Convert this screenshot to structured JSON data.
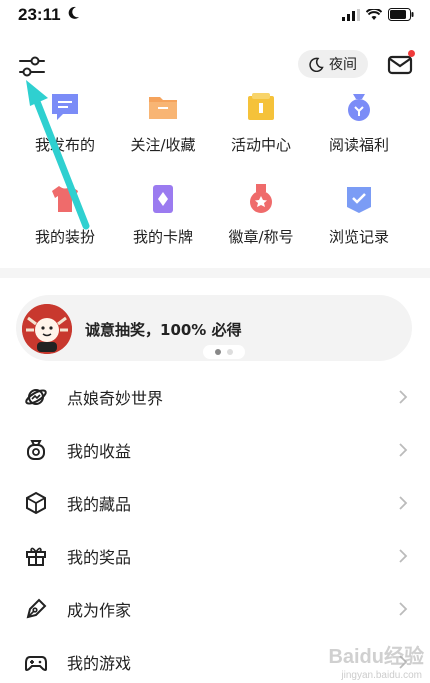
{
  "status_bar": {
    "time": "23:11"
  },
  "header": {
    "night_label": "夜间"
  },
  "grid": [
    {
      "label": "我发布的",
      "icon": "chat-bubble-icon",
      "color": "#7b8cf7"
    },
    {
      "label": "关注/收藏",
      "icon": "folder-icon",
      "color": "#f5a35c"
    },
    {
      "label": "活动中心",
      "icon": "gift-box-icon",
      "color": "#f5c23a"
    },
    {
      "label": "阅读福利",
      "icon": "coin-bag-icon",
      "color": "#7b8cf7"
    },
    {
      "label": "我的装扮",
      "icon": "tshirt-icon",
      "color": "#ef6b6b"
    },
    {
      "label": "我的卡牌",
      "icon": "card-icon",
      "color": "#9b7bf0"
    },
    {
      "label": "徽章/称号",
      "icon": "medal-icon",
      "color": "#ef6b6b"
    },
    {
      "label": "浏览记录",
      "icon": "history-icon",
      "color": "#7b9cf5"
    }
  ],
  "banner": {
    "text": "诚意抽奖，100% 必得"
  },
  "menu": [
    {
      "label": "点娘奇妙世界",
      "icon": "planet-icon"
    },
    {
      "label": "我的收益",
      "icon": "money-pot-icon"
    },
    {
      "label": "我的藏品",
      "icon": "cube-icon"
    },
    {
      "label": "我的奖品",
      "icon": "gift-icon"
    },
    {
      "label": "成为作家",
      "icon": "pen-icon"
    },
    {
      "label": "我的游戏",
      "icon": "gamepad-icon"
    }
  ],
  "watermark": {
    "text": "Baidu经验",
    "sub": "jingyan.baidu.com"
  }
}
